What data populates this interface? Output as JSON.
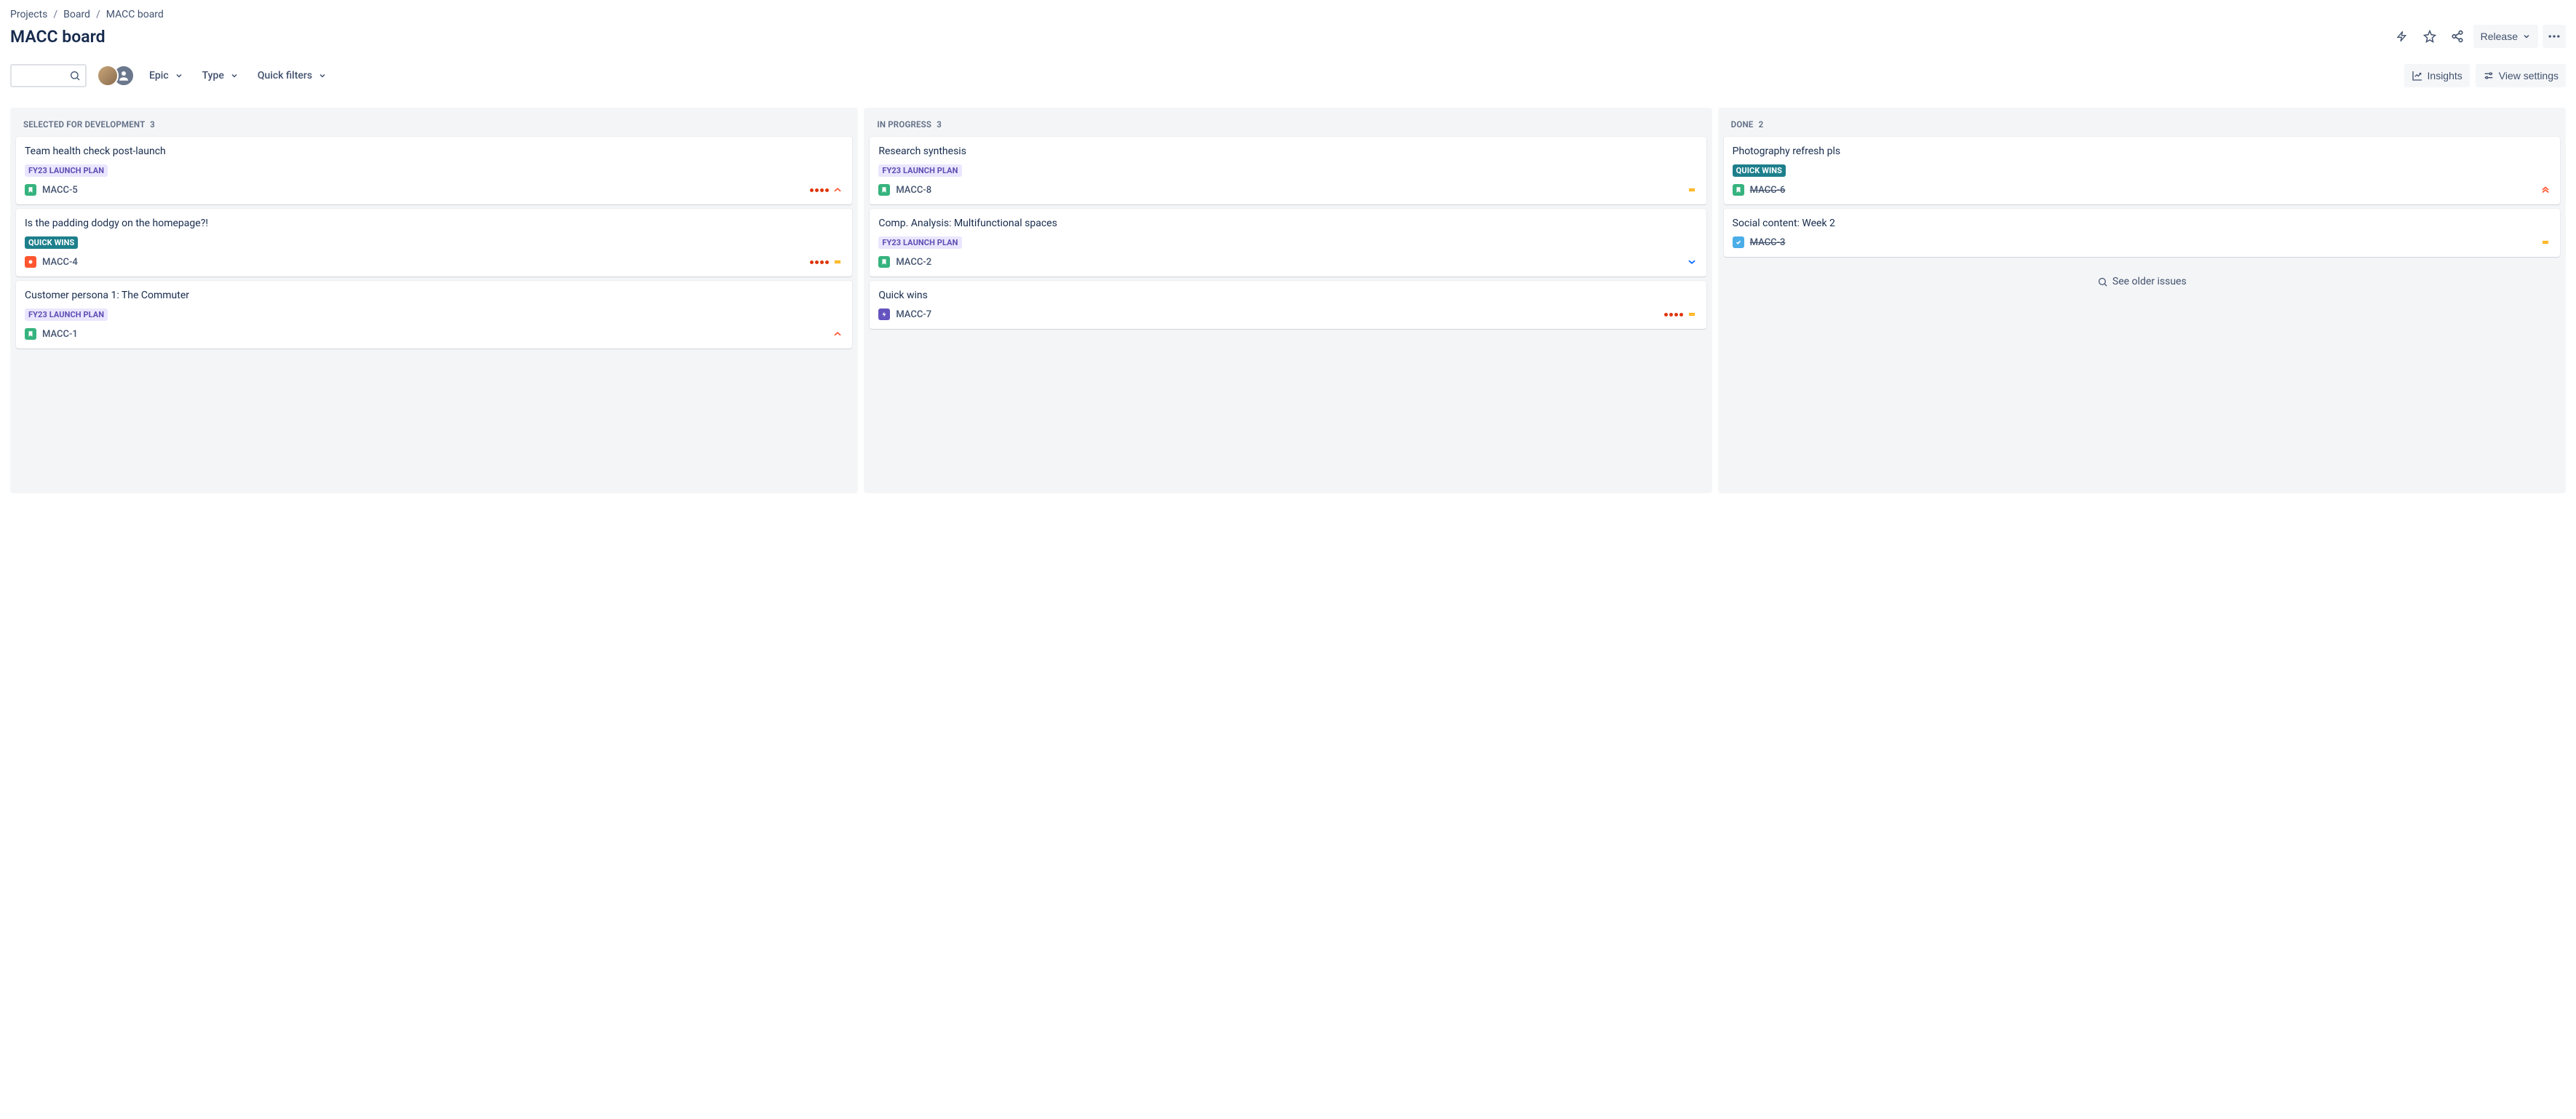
{
  "breadcrumb": {
    "projects": "Projects",
    "board": "Board",
    "current": "MACC board"
  },
  "page_title": "MACC board",
  "header": {
    "release": "Release"
  },
  "toolbar": {
    "search_placeholder": "",
    "epic": "Epic",
    "type": "Type",
    "quick_filters": "Quick filters",
    "insights": "Insights",
    "view_settings": "View settings"
  },
  "tags": {
    "launch": "FY23 LAUNCH PLAN",
    "quick": "QUICK WINS"
  },
  "columns": {
    "selected": {
      "title": "Selected for Development",
      "count": "3"
    },
    "in_progress": {
      "title": "In Progress",
      "count": "3"
    },
    "done": {
      "title": "Done",
      "count": "2",
      "see_older": "See older issues"
    }
  },
  "cards": {
    "c1": {
      "title": "Team health check post-launch",
      "key": "MACC-5"
    },
    "c2": {
      "title": "Is the padding dodgy on the homepage?!",
      "key": "MACC-4"
    },
    "c3": {
      "title": "Customer persona 1: The Commuter",
      "key": "MACC-1"
    },
    "c4": {
      "title": "Research synthesis",
      "key": "MACC-8"
    },
    "c5": {
      "title": "Comp. Analysis: Multifunctional spaces",
      "key": "MACC-2"
    },
    "c6": {
      "title": "Quick wins",
      "key": "MACC-7"
    },
    "c7": {
      "title": "Photography refresh pls",
      "key": "MACC-6"
    },
    "c8": {
      "title": "Social content: Week 2",
      "key": "MACC-3"
    }
  }
}
